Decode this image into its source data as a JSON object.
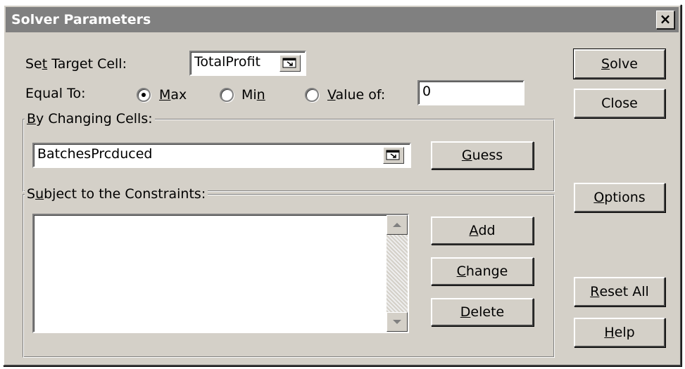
{
  "window": {
    "title": "Solver Parameters",
    "close_glyph": "×"
  },
  "target": {
    "label_pre": "Se",
    "label_key": "t",
    "label_post": " Target Cell:",
    "value": "TotalProfit"
  },
  "equal_to": {
    "label": "Equal To:",
    "max": {
      "pre": "",
      "key": "M",
      "post": "ax",
      "selected": true
    },
    "min": {
      "pre": "Mi",
      "key": "n",
      "post": "",
      "selected": false
    },
    "value_of": {
      "pre": "",
      "key": "V",
      "post": "alue of:",
      "selected": false,
      "value": "0"
    }
  },
  "changing": {
    "legend_key": "B",
    "legend_post": "y Changing Cells:",
    "value": "BatchesPrcduced"
  },
  "constraints": {
    "legend_pre": "S",
    "legend_key": "u",
    "legend_post": "bject to the Constraints:",
    "items": []
  },
  "buttons": {
    "solve": {
      "key": "S",
      "post": "olve"
    },
    "close": {
      "label": "Close"
    },
    "guess": {
      "key": "G",
      "post": "uess"
    },
    "options": {
      "key": "O",
      "post": "ptions"
    },
    "add": {
      "key": "A",
      "post": "dd"
    },
    "change": {
      "key": "C",
      "post": "hange"
    },
    "delete": {
      "key": "D",
      "post": "elete"
    },
    "reset_all": {
      "key": "R",
      "post": "eset All"
    },
    "help": {
      "key": "H",
      "post": "elp"
    }
  },
  "icons": {
    "collapse_dialog": "collapse-dialog-icon",
    "scroll_up": "scroll-up-arrow-icon",
    "scroll_down": "scroll-down-arrow-icon"
  },
  "colors": {
    "face": "#d4d0c8",
    "titlebar": "#808080",
    "field": "#ffffff"
  }
}
